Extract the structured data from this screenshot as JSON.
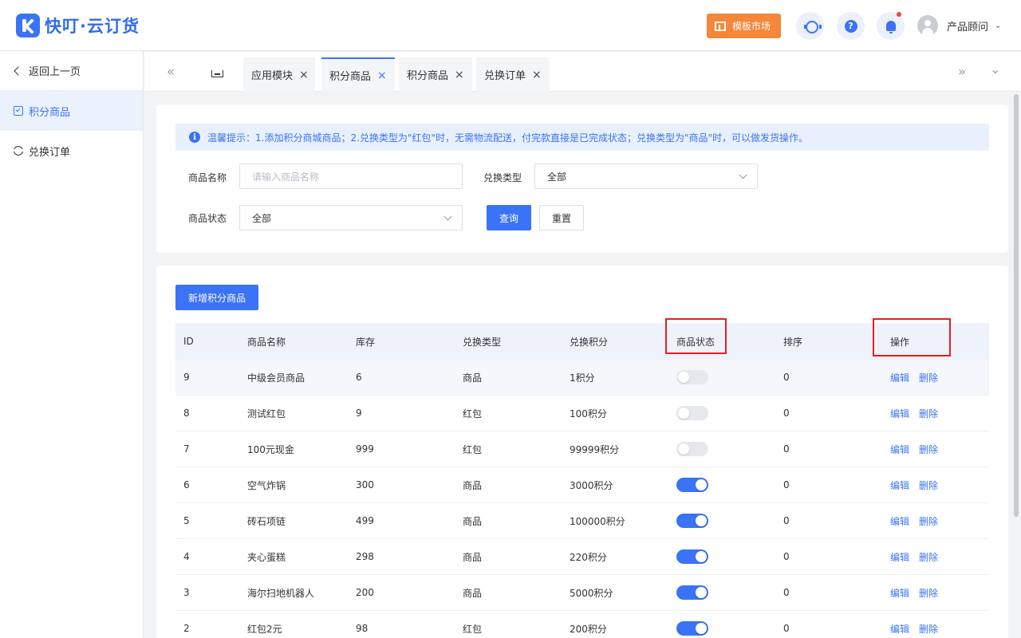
{
  "app": {
    "name": "快叮·云订货",
    "brand_color": "#3a73f6"
  },
  "header": {
    "market_label": "模板市场",
    "help_glyph": "?",
    "user_name": "产品顾问",
    "caret": "⌄"
  },
  "sidebar": {
    "back_label": "返回上一页",
    "items": [
      {
        "label": "积分商品",
        "icon": "checkbox-icon",
        "active": true
      },
      {
        "label": "兑换订单",
        "icon": "sync-icon",
        "active": false
      }
    ]
  },
  "tabs": {
    "left_arrow": "«",
    "right_arrow": "»",
    "dropdown": "⌄",
    "items": [
      {
        "label": "应用模块",
        "close": "×"
      },
      {
        "label": "积分商品",
        "close": "×",
        "active": true
      },
      {
        "label": "积分商品",
        "close": "×"
      },
      {
        "label": "兑换订单",
        "close": "×"
      }
    ]
  },
  "filter": {
    "tip_glyph": "i",
    "tip": "温馨提示：1.添加积分商城商品；2.兑换类型为\"红包\"时，无需物流配送，付完款直接是已完成状态；兑换类型为\"商品\"时，可以做发货操作。",
    "name_label": "商品名称",
    "name_placeholder": "请输入商品名称",
    "type_label": "兑换类型",
    "type_value": "全部",
    "status_label": "商品状态",
    "status_value": "全部",
    "query_label": "查询",
    "reset_label": "重置"
  },
  "table": {
    "add_label": "新增积分商品",
    "columns": [
      "ID",
      "商品名称",
      "库存",
      "兑换类型",
      "兑换积分",
      "商品状态",
      "排序",
      "操作"
    ],
    "edit_label": "编辑",
    "delete_label": "删除",
    "rows": [
      {
        "id": "9",
        "name": "中级会员商品",
        "stock": "6",
        "type": "商品",
        "points": "1积分",
        "status_on": false,
        "sort": "0"
      },
      {
        "id": "8",
        "name": "测试红包",
        "stock": "9",
        "type": "红包",
        "points": "100积分",
        "status_on": false,
        "sort": "0"
      },
      {
        "id": "7",
        "name": "100元现金",
        "stock": "999",
        "type": "红包",
        "points": "99999积分",
        "status_on": false,
        "sort": "0"
      },
      {
        "id": "6",
        "name": "空气炸锅",
        "stock": "300",
        "type": "商品",
        "points": "3000积分",
        "status_on": true,
        "sort": "0"
      },
      {
        "id": "5",
        "name": "砖石项链",
        "stock": "499",
        "type": "商品",
        "points": "100000积分",
        "status_on": true,
        "sort": "0"
      },
      {
        "id": "4",
        "name": "夹心蛋糕",
        "stock": "298",
        "type": "商品",
        "points": "220积分",
        "status_on": true,
        "sort": "0"
      },
      {
        "id": "3",
        "name": "海尔扫地机器人",
        "stock": "200",
        "type": "商品",
        "points": "5000积分",
        "status_on": true,
        "sort": "0"
      },
      {
        "id": "2",
        "name": "红包2元",
        "stock": "98",
        "type": "红包",
        "points": "200积分",
        "status_on": true,
        "sort": "0"
      }
    ]
  },
  "colors": {
    "primary": "#3a73f6",
    "orange": "#f4873a",
    "highlight_border": "#e02020"
  }
}
